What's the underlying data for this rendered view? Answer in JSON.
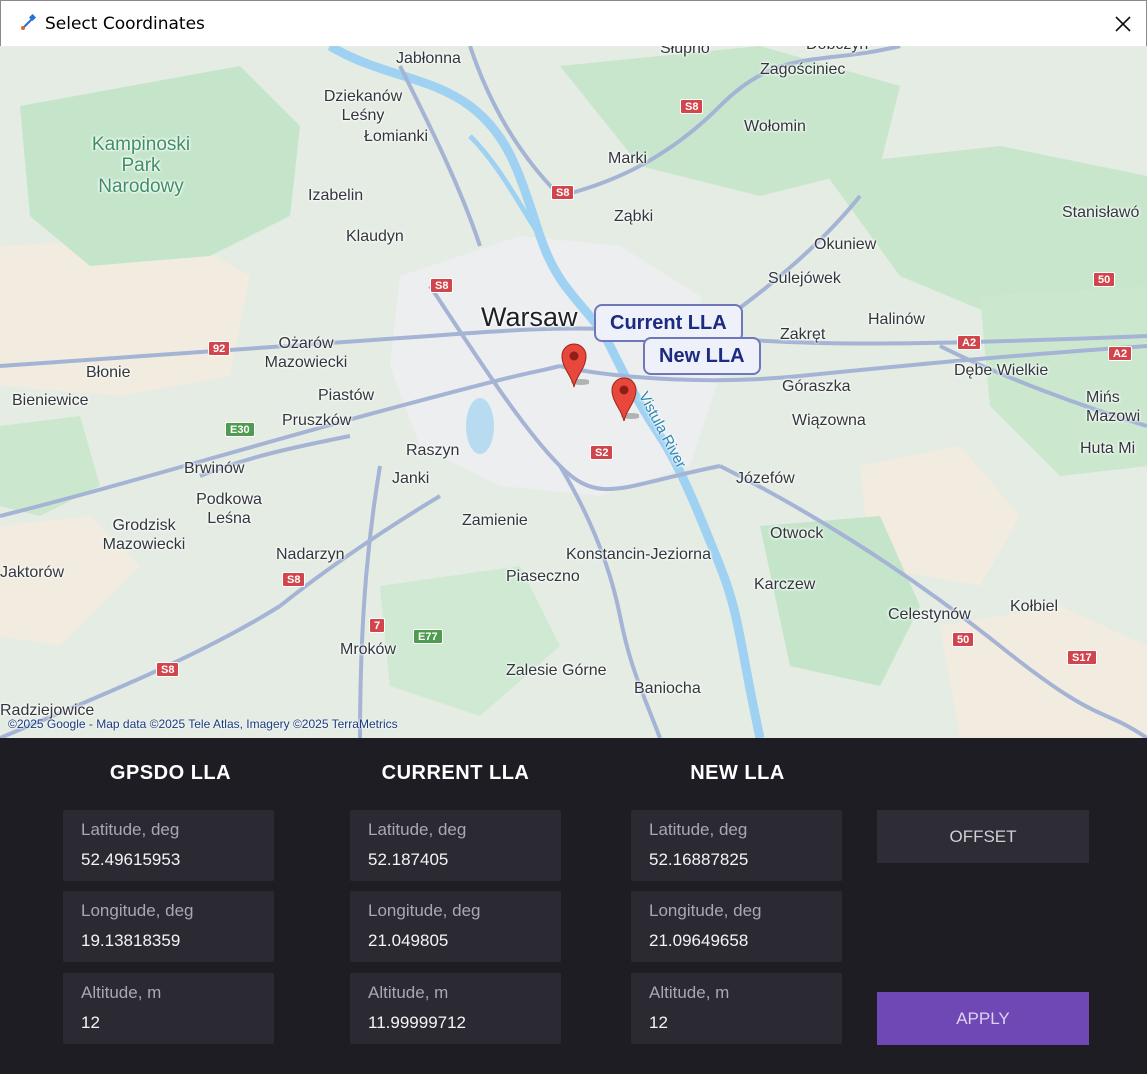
{
  "window": {
    "title": "Select Coordinates",
    "close_icon": "close-icon",
    "app_icon": "satellite-icon"
  },
  "map": {
    "labels": {
      "jablonna": "Jabłonna",
      "slupno": "Słupno",
      "dobczyn": "Dobczyn",
      "zagosciniec": "Zagościniec",
      "dziekanow": "Dziekanów Leśny",
      "lomianki": "Łomianki",
      "wolomin": "Wołomin",
      "kampinoski": "Kampinoski Park Narodowy",
      "marki": "Marki",
      "izabelin": "Izabelin",
      "zabki": "Ząbki",
      "stanislawow": "Stanisławó",
      "klaudyn": "Klaudyn",
      "okuniew": "Okuniew",
      "sulejowek": "Sulejówek",
      "warsaw": "Warsaw",
      "halinow": "Halinów",
      "zakret": "Zakręt",
      "ozarow": "Ożarów Mazowiecki",
      "debe": "Dębe Wielkie",
      "blonie": "Błonie",
      "goraszka": "Góraszka",
      "piastow": "Piastów",
      "bieniewice": "Bieniewice",
      "minsk": "Mińs Mazowi",
      "pruszkow": "Pruszków",
      "wiazowna": "Wiązowna",
      "raszyn": "Raszyn",
      "huta": "Huta Mi",
      "brwinow": "Brwinów",
      "janki": "Janki",
      "jozefow": "Józefów",
      "podkowa": "Podkowa Leśna",
      "grodzisk": "Grodzisk Mazowiecki",
      "zamienie": "Zamienie",
      "otwock": "Otwock",
      "nadarzyn": "Nadarzyn",
      "konstancin": "Konstancin-Jeziorna",
      "jaktorow": "Jaktorów",
      "piaseczno": "Piaseczno",
      "karczew": "Karczew",
      "celestynow": "Celestynów",
      "kolbiel": "Kołbiel",
      "mrokow": "Mroków",
      "zalesie": "Zalesie Górne",
      "baniocha": "Baniocha",
      "radziejowice": "Radziejowice",
      "river": "Vistula River"
    },
    "shields": {
      "s8a": "S8",
      "s8b": "S8",
      "s8c": "S8",
      "s8d": "S8",
      "s8e": "S8",
      "r92": "92",
      "r50a": "50",
      "r50b": "50",
      "a2a": "A2",
      "a2b": "A2",
      "e30": "E30",
      "s2": "S2",
      "r7": "7",
      "e77": "E77",
      "s17": "S17"
    },
    "callouts": {
      "current": "Current LLA",
      "new": "New LLA"
    },
    "attribution": "©2025 Google - Map data ©2025 Tele Atlas, Imagery ©2025 TerraMetrics",
    "colors": {
      "land": "#e4ece3",
      "forest": "#c5e5cb",
      "water": "#9fd2f2",
      "road": "#a5b4d4",
      "marker": "#e8473c"
    }
  },
  "panel": {
    "gpsdo": {
      "heading": "GPSDO LLA",
      "lat_label": "Latitude, deg",
      "lat_value": "52.49615953",
      "lon_label": "Longitude, deg",
      "lon_value": "19.13818359",
      "alt_label": "Altitude, m",
      "alt_value": "12"
    },
    "current": {
      "heading": "CURRENT LLA",
      "lat_label": "Latitude, deg",
      "lat_value": "52.187405",
      "lon_label": "Longitude, deg",
      "lon_value": "21.049805",
      "alt_label": "Altitude, m",
      "alt_value": "11.99999712"
    },
    "new": {
      "heading": "NEW LLA",
      "lat_label": "Latitude, deg",
      "lat_value": "52.16887825",
      "lon_label": "Longitude, deg",
      "lon_value": "21.09649658",
      "alt_label": "Altitude, m",
      "alt_value": "12"
    },
    "buttons": {
      "offset": "OFFSET",
      "apply": "APPLY"
    },
    "colors": {
      "background": "#1e1d24",
      "field": "#2b2a33",
      "apply": "#6f48b5"
    }
  }
}
